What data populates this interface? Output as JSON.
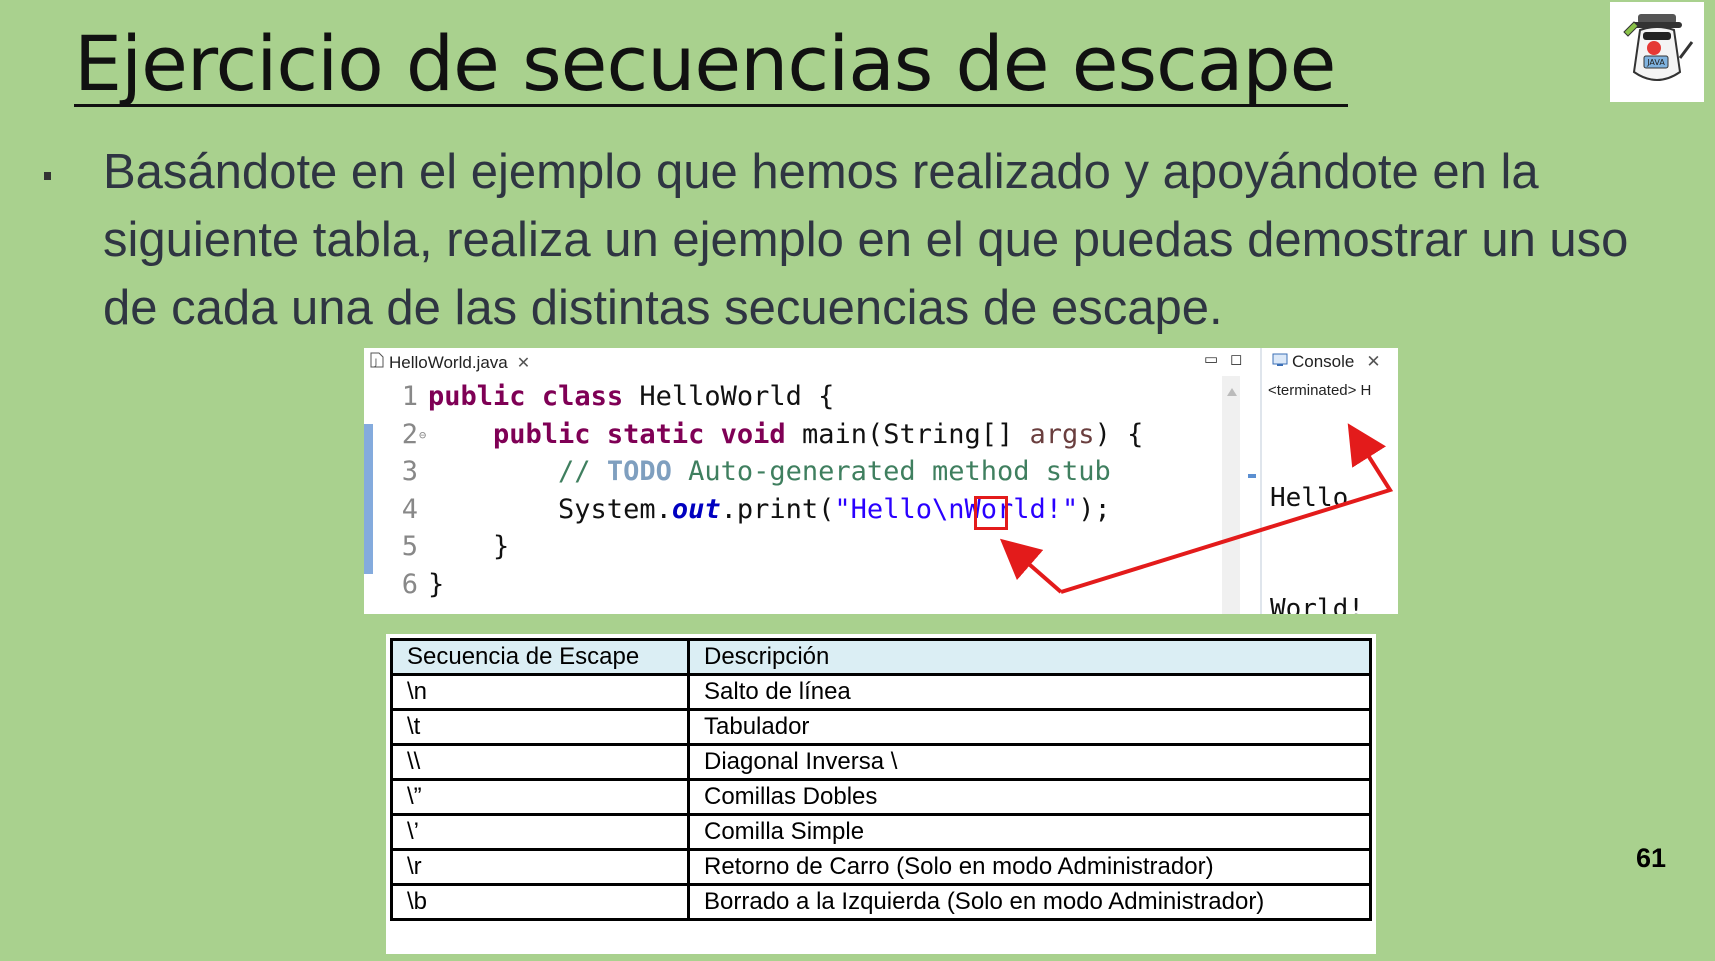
{
  "slide": {
    "title": "Ejercicio de secuencias de escape",
    "bullet": "Basándote en el ejemplo que hemos realizado y apoyándote en la siguiente tabla, realiza un ejemplo en el que puedas demostrar un uso de cada una de las distintas secuencias de escape.",
    "page_number": "61"
  },
  "ide": {
    "editor_tab": "HelloWorld.java",
    "console_tab": "Console",
    "console_status": "<terminated> H",
    "code_lines": [
      {
        "n": "1",
        "parts": [
          {
            "t": "public",
            "c": "kw"
          },
          {
            "t": " "
          },
          {
            "t": "class",
            "c": "kw"
          },
          {
            "t": " HelloWorld {"
          }
        ]
      },
      {
        "n": "2",
        "fold": "⊖",
        "parts": [
          {
            "t": "    "
          },
          {
            "t": "public",
            "c": "kw"
          },
          {
            "t": " "
          },
          {
            "t": "static",
            "c": "kw"
          },
          {
            "t": " "
          },
          {
            "t": "void",
            "c": "kw"
          },
          {
            "t": " main(String[] "
          },
          {
            "t": "args",
            "c": "param"
          },
          {
            "t": ") {"
          }
        ]
      },
      {
        "n": "3",
        "parts": [
          {
            "t": "        "
          },
          {
            "t": "// ",
            "c": "cm"
          },
          {
            "t": "TODO",
            "c": "todo"
          },
          {
            "t": " Auto-generated method stub",
            "c": "cm"
          }
        ]
      },
      {
        "n": "4",
        "parts": [
          {
            "t": "        System."
          },
          {
            "t": "out",
            "c": "fld"
          },
          {
            "t": ".print("
          },
          {
            "t": "\"Hello\\nWorld!\"",
            "c": "str"
          },
          {
            "t": ");"
          }
        ]
      },
      {
        "n": "5",
        "parts": [
          {
            "t": "    }"
          }
        ]
      },
      {
        "n": "6",
        "parts": [
          {
            "t": "}"
          }
        ]
      }
    ],
    "console_output": [
      "Hello",
      "World!"
    ]
  },
  "table": {
    "headers": [
      "Secuencia de Escape",
      "Descripción"
    ],
    "rows": [
      [
        "\\n",
        "Salto de línea"
      ],
      [
        "\\t",
        "Tabulador"
      ],
      [
        "\\\\",
        "Diagonal Inversa \\"
      ],
      [
        "\\”",
        "Comillas Dobles"
      ],
      [
        "\\’",
        "Comilla Simple"
      ],
      [
        "\\r",
        "Retorno de Carro (Solo en modo Administrador)"
      ],
      [
        "\\b",
        "Borrado a la Izquierda (Solo en modo Administrador)"
      ]
    ]
  },
  "colors": {
    "background": "#a9d18e",
    "annotation": "#e31b1b",
    "keyword": "#7f0055",
    "string": "#2a00ff",
    "comment": "#3f7f5f",
    "table_header": "#dbeef4"
  },
  "icons": [
    "java-duke-logo-icon",
    "java-file-icon",
    "console-icon",
    "close-icon",
    "minimize-icon",
    "maximize-icon"
  ]
}
